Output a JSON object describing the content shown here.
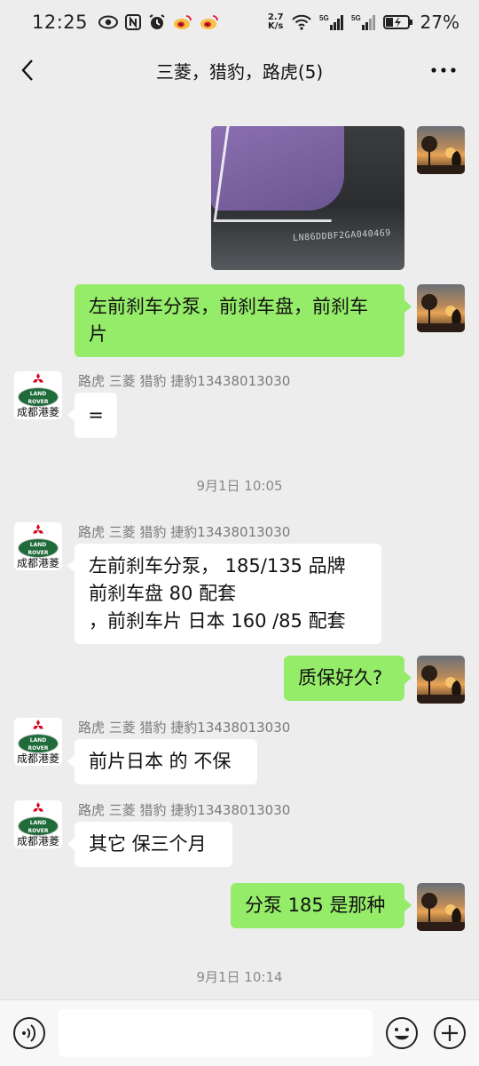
{
  "status_bar": {
    "time": "12:25",
    "net_speed_value": "2.7",
    "net_speed_unit": "K/s",
    "network_1": "5G",
    "network_2": "5G",
    "battery": "27%"
  },
  "header": {
    "title": "三菱，猎豹，路虎(5)"
  },
  "contact": {
    "name": "路虎 三菱 猎豹 捷豹13438013030",
    "avatar_caption": "成都港菱",
    "badge_line1": "LAND",
    "badge_line2": "ROVER"
  },
  "messages": {
    "m1_lines": [
      "左前刹车分泵，前刹车盘，前刹车",
      "片"
    ],
    "m2_text": "=",
    "ts1": "9月1日 10:05",
    "m3_lines": [
      "左前刹车分泵， 185/135 品牌",
      "前刹车盘 80 配套",
      "，前刹车片 日本  160 /85 配套"
    ],
    "m4_text": "质保好久?",
    "m5_text": "前片日本 的 不保",
    "m6_text": "其它 保三个月",
    "m7_text": "分泵 185 是那种",
    "ts2": "9月1日 10:14"
  },
  "photo": {
    "vin_text": "LN86DDBF2GA040469"
  },
  "input": {
    "value": "",
    "placeholder": ""
  },
  "colors": {
    "background": "#ededed",
    "outgoing_bubble": "#95ec69",
    "incoming_bubble": "#ffffff"
  }
}
